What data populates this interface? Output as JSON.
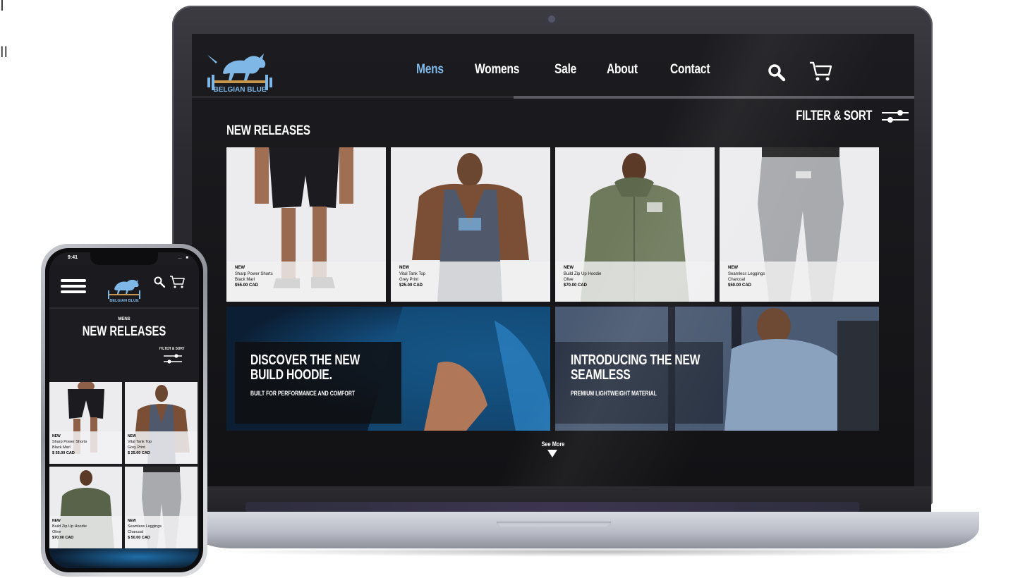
{
  "corner": {
    "glyph1": "I",
    "glyph2": "ll"
  },
  "desktop": {
    "logo_text": "BELGIAN BLUE",
    "nav": [
      {
        "label": "Mens",
        "active": true
      },
      {
        "label": "Womens",
        "active": false
      },
      {
        "label": "Sale",
        "active": false
      },
      {
        "label": "About",
        "active": false
      },
      {
        "label": "Contact",
        "active": false
      }
    ],
    "filter_label": "FILTER & SORT",
    "section_title": "NEW RELEASES",
    "products": [
      {
        "tag": "NEW",
        "name": "Sharp Power Shorts",
        "color": "Black Marl",
        "price": "$55.00 CAD"
      },
      {
        "tag": "NEW",
        "name": "Vital Tank Top",
        "color": "Grey Print",
        "price": "$25.00 CAD"
      },
      {
        "tag": "NEW",
        "name": "Build Zip Up Hoodie",
        "color": "Olive",
        "price": "$70.00 CAD"
      },
      {
        "tag": "NEW",
        "name": "Seamless Leggings",
        "color": "Charcoal",
        "price": "$50.00 CAD"
      }
    ],
    "banners": [
      {
        "title_line1": "DISCOVER THE NEW",
        "title_line2": "BUILD HOODIE.",
        "subtitle": "BUILT FOR PERFORMANCE AND COMFORT"
      },
      {
        "title_line1": "INTRODUCING THE NEW",
        "title_line2": "SEAMLESS",
        "subtitle": "PREMIUM LIGHTWEIGHT MATERIAL"
      }
    ],
    "see_more": "See More"
  },
  "mobile": {
    "time": "9:41",
    "status_icons": "… ■",
    "logo_text": "BELGIAN BLUE",
    "subtitle": "MENS",
    "title": "NEW RELEASES",
    "filter_label": "FILTER & SORT",
    "products": [
      {
        "tag": "NEW",
        "name": "Sharp Power Shorts",
        "color": "Black Marl",
        "price": "$ 55.00 CAD"
      },
      {
        "tag": "NEW",
        "name": "Vital Tank Top",
        "color": "Grey Print",
        "price": "$ 25.00 CAD"
      },
      {
        "tag": "NEW",
        "name": "Build Zip Up Hoodie",
        "color": "Olive",
        "price": "$70.00 CAD"
      },
      {
        "tag": "NEW",
        "name": "Seamless Leggings",
        "color": "Charcoal",
        "price": "$ 50.00 CAD"
      }
    ]
  },
  "colors": {
    "accent": "#7fb8e6",
    "logo_gold": "#c8964a",
    "screen_bg": "#1a1a1e"
  }
}
